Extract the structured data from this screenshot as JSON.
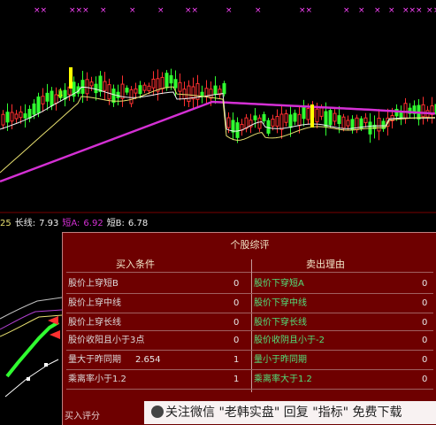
{
  "colors": {
    "background": "#000000",
    "up_candle": "#ff3030",
    "down_candle": "#30ff30",
    "ma_long": "#d430d4",
    "ma_short": "#f0f0f0",
    "ma_mid": "#e8e070",
    "signal_marker": "#ff44ff",
    "panel_bg": "#6e0000"
  },
  "top_markers": [
    "××",
    "×××",
    "×",
    "×",
    "×",
    "××",
    "×",
    "×",
    "××",
    "×",
    "×",
    "×",
    "×",
    "××",
    "×",
    "×",
    "×"
  ],
  "indicator_bar": {
    "value0": "25",
    "long_label": "长线:",
    "long_value": "7.93",
    "shortA_label": "短A:",
    "shortA_value": "6.92",
    "shortB_label": "短B:",
    "shortB_value": "6.78"
  },
  "panel": {
    "title": "个股综评",
    "buy_header": "买入条件",
    "sell_header": "卖出理由",
    "buy_rows": [
      {
        "label": "股价上穿短B",
        "extra": "",
        "value": "0"
      },
      {
        "label": "股价上穿中线",
        "extra": "",
        "value": "0"
      },
      {
        "label": "股价上穿长线",
        "extra": "",
        "value": "0"
      },
      {
        "label": "股价收阳且小于3点",
        "extra": "",
        "value": "0"
      },
      {
        "label": "量大于昨同期",
        "extra": "2.654",
        "value": "1"
      },
      {
        "label": "乘离率小于1.2",
        "extra": "",
        "value": "1"
      }
    ],
    "sell_rows": [
      {
        "label": "股价下穿短A",
        "value": "0"
      },
      {
        "label": "股价下穿中线",
        "value": "0"
      },
      {
        "label": "股价下穿长线",
        "value": "0"
      },
      {
        "label": "股价收阴且小于-2",
        "value": "0"
      },
      {
        "label": "量小于昨同期",
        "value": "0"
      },
      {
        "label": "乘离率大于1.2",
        "value": "0"
      }
    ],
    "bottom_label": "买入评分"
  },
  "watermark": {
    "text": "关注微信 \"老韩实盘\" 回复 \"指标\" 免费下载"
  }
}
